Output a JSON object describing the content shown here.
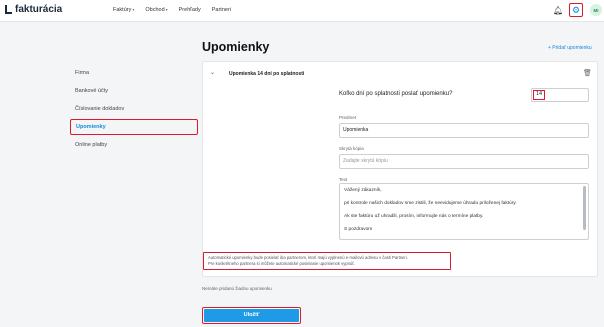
{
  "app": {
    "logo_text": "fakturácia"
  },
  "nav": {
    "items": [
      {
        "label": "Faktúry",
        "caret": "▾"
      },
      {
        "label": "Obchod",
        "caret": "▾"
      },
      {
        "label": "Prehľady",
        "caret": ""
      },
      {
        "label": "Partneri",
        "caret": ""
      }
    ]
  },
  "header": {
    "avatar_initials": "MI"
  },
  "page": {
    "title": "Upomienky",
    "add_link": "+ Pridať upomienku"
  },
  "sidebar": {
    "items": [
      {
        "label": "Firma"
      },
      {
        "label": "Bankové účty"
      },
      {
        "label": "Číslovanie dokladov"
      },
      {
        "label": "Upomienky",
        "active": true
      },
      {
        "label": "Online platby"
      }
    ]
  },
  "reminder": {
    "title": "Upomienka 14 dní po splatnosti",
    "days_label": "Koľko dní po splatnosti poslať upomienku?",
    "days_value": "14",
    "subject_label": "Predmet",
    "subject_value": "Upomienka",
    "bcc_label": "Skrytá kópia",
    "bcc_placeholder": "Zadajte skrytú kópiu",
    "text_label": "Text",
    "text_lines": [
      "Vážený zákazník,",
      "pri kontrole našich dokladov sme zistili, že neevidujeme úhradu priloženej faktúry.",
      "Ak ste faktúru už uhradili, prosím, informujte nás o termíne platby.",
      "S pozdravom"
    ],
    "info_lines": [
      "Automatické upomienky bude posielať iba partnerom, ktorí majú vyplnenú e-mailovú adresu v časti Partneri.",
      "Pre konkrétneho partnera si môžete automatické posielanie upomienok vypnúť."
    ]
  },
  "footer": {
    "empty_note": "Nemáte pridanú žiadnu upomienku",
    "save_label": "Uložiť"
  },
  "colors": {
    "accent": "#1a88d8",
    "highlight": "#e0182d",
    "button": "#1f9ae6"
  }
}
